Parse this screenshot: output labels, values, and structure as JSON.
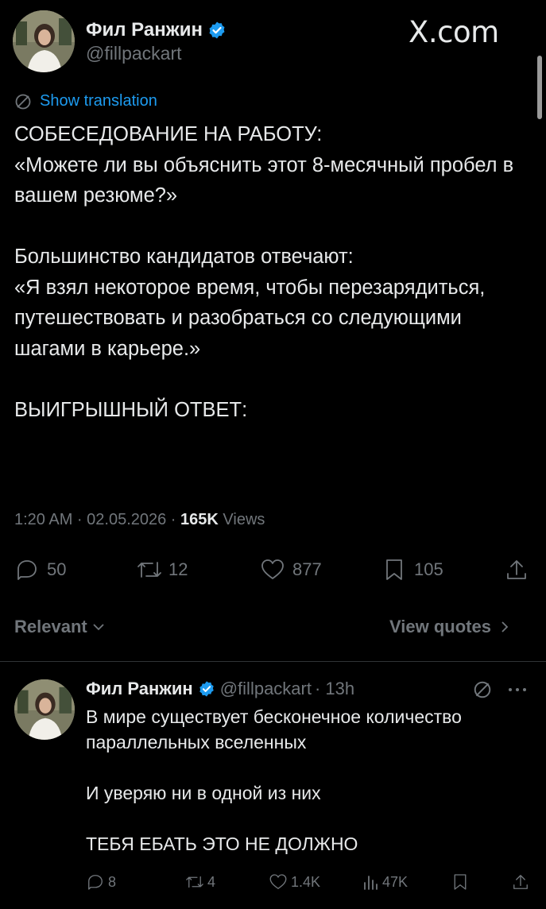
{
  "brand": "X.com",
  "tweet": {
    "author_name": "Фил Ранжин",
    "author_handle": "@fillpackart",
    "show_translation": "Show translation",
    "body": "СОБЕСЕДОВАНИЕ НА РАБОТУ:\n«Можете ли вы объяснить этот 8-месячный пробел в вашем резюме?»\n\nБольшинство кандидатов отвечают:\n«Я взял некоторое время, чтобы перезарядиться, путешествовать и разобраться со следующими шагами в карьере.»\n\nВЫИГРЫШНЫЙ ОТВЕТ:",
    "time": "1:20 AM · 02.05.2026 · ",
    "views_count": "165K",
    "views_label": " Views",
    "actions": {
      "replies": "50",
      "reposts": "12",
      "likes": "877",
      "bookmarks": "105"
    }
  },
  "sort": {
    "relevant_label": "Relevant",
    "view_quotes_label": "View quotes"
  },
  "reply": {
    "author_name": "Фил Ранжин",
    "author_handle": "@fillpackart",
    "time": "· 13h",
    "body": "В мире существует бесконечное количество параллельных вселенных\n\nИ уверяю ни в одной из них\n\nТЕБЯ ЕБАТЬ ЭТО НЕ ДОЛЖНО",
    "actions": {
      "replies": "8",
      "reposts": "4",
      "likes": "1.4K",
      "views": "47K"
    }
  },
  "colors": {
    "background": "#000000",
    "text": "#e7e9ea",
    "muted": "#71767b",
    "link": "#1d9bf0",
    "verified": "#1d9bf0"
  }
}
